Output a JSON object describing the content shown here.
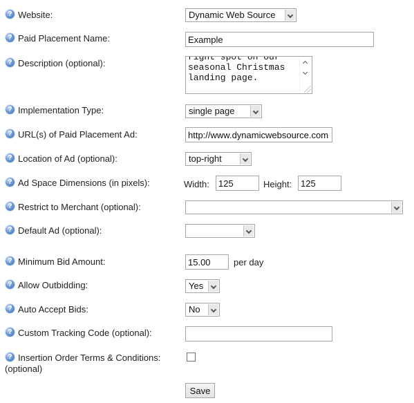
{
  "form": {
    "website": {
      "label": "Website:",
      "value": "Dynamic Web Source"
    },
    "name": {
      "label": "Paid Placement Name:",
      "value": "Example"
    },
    "description": {
      "label": "Description (optional):",
      "value": "right spot on our\nseasonal Christmas\nlanding page."
    },
    "implementation": {
      "label": "Implementation Type:",
      "value": "single page"
    },
    "url": {
      "label": "URL(s) of Paid Placement Ad:",
      "value": "http://www.dynamicwebsource.com"
    },
    "location": {
      "label": "Location of Ad (optional):",
      "value": "top-right"
    },
    "dimensions": {
      "label": "Ad Space Dimensions (in pixels):",
      "width_label": "Width:",
      "width_value": "125",
      "height_label": "Height:",
      "height_value": "125"
    },
    "merchant": {
      "label": "Restrict to Merchant (optional):",
      "value": ""
    },
    "default_ad": {
      "label": "Default Ad (optional):",
      "value": ""
    },
    "min_bid": {
      "label": "Minimum Bid Amount:",
      "value": "15.00",
      "suffix": "per day"
    },
    "outbidding": {
      "label": "Allow Outbidding:",
      "value": "Yes"
    },
    "auto_accept": {
      "label": "Auto Accept Bids:",
      "value": "No"
    },
    "tracking": {
      "label": "Custom Tracking Code (optional):",
      "value": ""
    },
    "terms": {
      "label": "Insertion Order Terms & Conditions:",
      "label_line2": "(optional)",
      "checked": false
    },
    "save_label": "Save",
    "help_glyph": "?"
  }
}
